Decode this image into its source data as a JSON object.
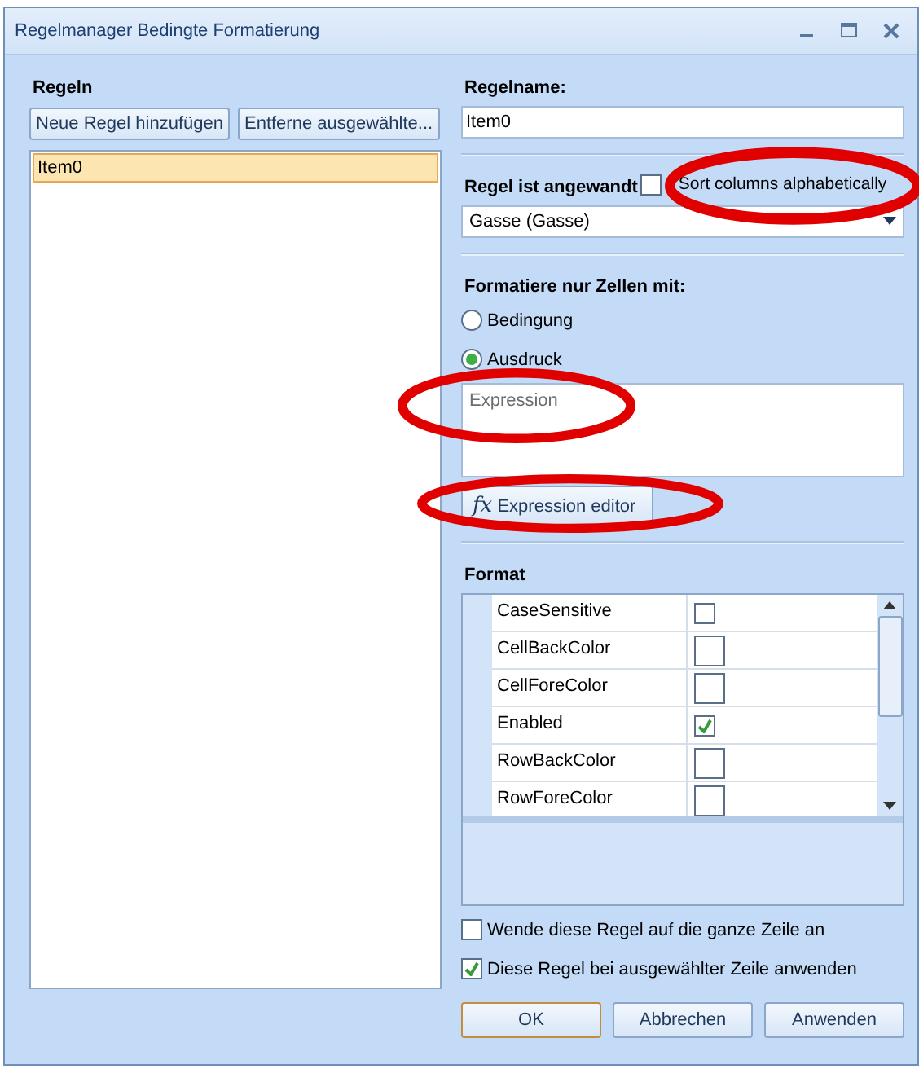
{
  "window": {
    "title": "Regelmanager Bedingte Formatierung"
  },
  "rules": {
    "heading": "Regeln",
    "add_button": "Neue Regel hinzufügen",
    "remove_button": "Entferne ausgewählte...",
    "items": [
      {
        "label": "Item0",
        "selected": true
      }
    ]
  },
  "rule_name": {
    "label": "Regelname:",
    "value": "Item0"
  },
  "applied": {
    "label": "Regel ist angewandt",
    "sort_label": "Sort columns alphabetically",
    "sort_checked": false,
    "sort_circled": true,
    "column": "Gasse (Gasse)"
  },
  "format_only": {
    "label": "Formatiere nur Zellen mit:",
    "options": [
      {
        "label": "Bedingung",
        "selected": false
      },
      {
        "label": "Ausdruck",
        "selected": true
      }
    ],
    "expression": {
      "placeholder": "Expression",
      "circled": true
    },
    "editor_button": {
      "icon": "fx",
      "label": "Expression editor",
      "circled": true
    }
  },
  "format": {
    "heading": "Format",
    "properties": [
      {
        "name": "CaseSensitive",
        "kind": "checkbox",
        "checked": false
      },
      {
        "name": "CellBackColor",
        "kind": "color"
      },
      {
        "name": "CellForeColor",
        "kind": "color"
      },
      {
        "name": "Enabled",
        "kind": "checkbox",
        "checked": true
      },
      {
        "name": "RowBackColor",
        "kind": "color"
      },
      {
        "name": "RowForeColor",
        "kind": "color"
      }
    ]
  },
  "options": [
    {
      "label": "Wende diese Regel auf die ganze Zeile an",
      "checked": false
    },
    {
      "label": "Diese Regel bei ausgewählter Zeile anwenden",
      "checked": true
    }
  ],
  "buttons": [
    {
      "label": "OK",
      "default": true
    },
    {
      "label": "Abbrechen",
      "default": false
    },
    {
      "label": "Anwenden",
      "default": false
    }
  ]
}
